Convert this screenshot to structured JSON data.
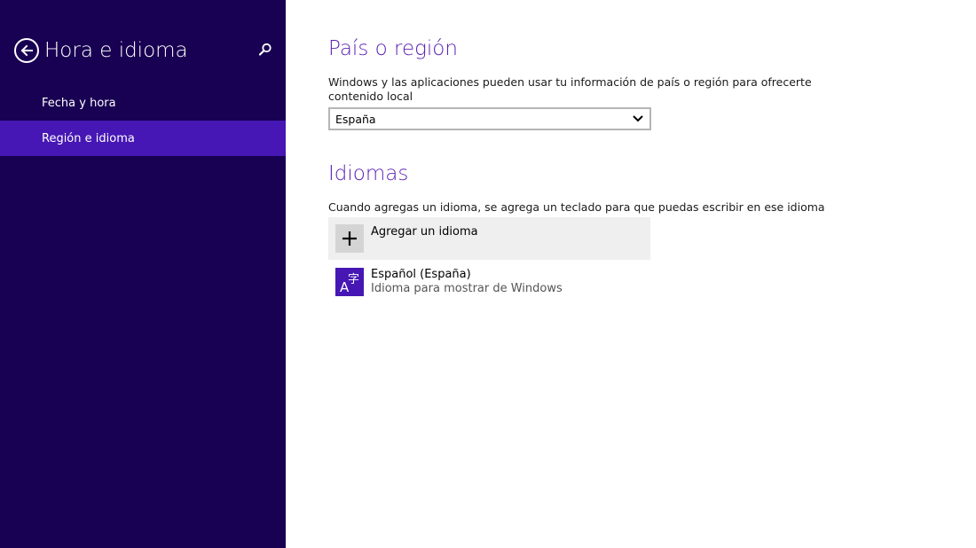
{
  "colors": {
    "sidebar_bg": "#180052",
    "sidebar_selected": "#4617b4",
    "accent_title": "#5a1fb4",
    "add_button_bg": "#efefef",
    "plus_box_bg": "#d4d4d4",
    "language_icon_bg": "#4617b4"
  },
  "sidebar": {
    "back_icon": "back-arrow-circle-icon",
    "title": "Hora e idioma",
    "search_icon": "search-icon",
    "items": [
      {
        "label": "Fecha y hora",
        "selected": false
      },
      {
        "label": "Región e idioma",
        "selected": true
      }
    ]
  },
  "region": {
    "title": "País o región",
    "description_line1": "Windows y las aplicaciones pueden usar tu información de país o región para ofrecerte",
    "description_line2": "contenido local",
    "selected_country": "España",
    "dropdown_icon": "chevron-down-icon"
  },
  "languages": {
    "title": "Idiomas",
    "description": "Cuando agregas un idioma, se agrega un teclado para que puedas escribir en ese idioma",
    "add_label": "Agregar un idioma",
    "add_icon": "plus-icon",
    "items": [
      {
        "name": "Español (España)",
        "subtitle": "Idioma para mostrar de Windows",
        "icon": "language-icon"
      }
    ]
  }
}
